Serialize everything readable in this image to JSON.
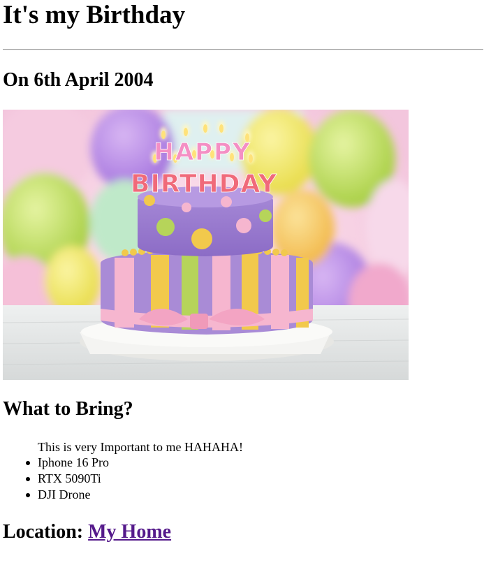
{
  "page": {
    "title": "It's my Birthday",
    "date_heading": "On 6th April 2004",
    "bring_heading": "What to Bring?",
    "bring_note": "This is very Important to me HAHAHA!",
    "bring_items": [
      "Iphone 16 Pro",
      "RTX 5090Ti",
      "DJI Drone"
    ],
    "location_label": "Location:",
    "location_link_text": "My Home"
  },
  "image": {
    "cake_top_text": "HAPPY",
    "cake_bottom_text": "BIRTHDAY"
  },
  "colors": {
    "link_visited": "#551a8b",
    "rule": "#9a9a9a",
    "cake_purple": "#a98bd6",
    "cake_yellow": "#f2c94c",
    "cake_green": "#b6d45a",
    "cake_pink": "#f6b6cf"
  }
}
